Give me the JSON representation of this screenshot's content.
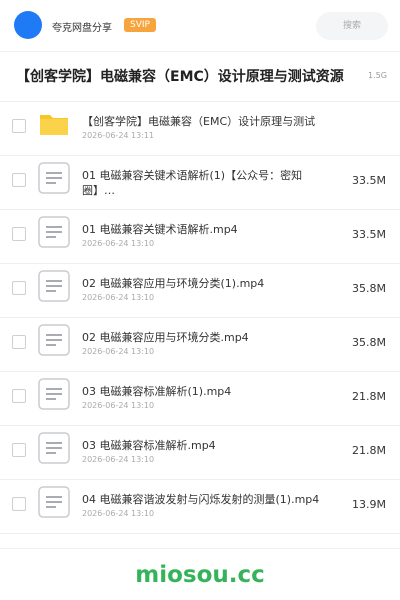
{
  "header": {
    "username": "夸克网盘分享",
    "badge": "SVIP",
    "search_placeholder": "搜索"
  },
  "folder_title": "【创客学院】电磁兼容（EMC）设计原理与测试资源",
  "total_size": "1.5G",
  "items": [
    {
      "type": "folder",
      "name": "【创客学院】电磁兼容（EMC）设计原理与测试",
      "date": "2026-06-24 13:11",
      "size": ""
    },
    {
      "type": "file",
      "name": "01 电磁兼容关键术语解析(1)【公众号：密知圈】…",
      "date": "",
      "size": "33.5M"
    },
    {
      "type": "file",
      "name": "01 电磁兼容关键术语解析.mp4",
      "date": "2026-06-24 13:10",
      "size": "33.5M"
    },
    {
      "type": "file",
      "name": "02 电磁兼容应用与环境分类(1).mp4",
      "date": "2026-06-24 13:10",
      "size": "35.8M"
    },
    {
      "type": "file",
      "name": "02 电磁兼容应用与环境分类.mp4",
      "date": "2026-06-24 13:10",
      "size": "35.8M"
    },
    {
      "type": "file",
      "name": "03 电磁兼容标准解析(1).mp4",
      "date": "2026-06-24 13:10",
      "size": "21.8M"
    },
    {
      "type": "file",
      "name": "03 电磁兼容标准解析.mp4",
      "date": "2026-06-24 13:10",
      "size": "21.8M"
    },
    {
      "type": "file",
      "name": "04 电磁兼容谐波发射与闪烁发射的测量(1).mp4",
      "date": "2026-06-24 13:10",
      "size": "13.9M"
    }
  ],
  "watermark": "miosou.cc",
  "colors": {
    "accent": "#1e7af5",
    "badge": "#f7a43d",
    "folder": "#f9c529",
    "watermark": "#35b35a"
  },
  "icons": {
    "folder": "folder-icon",
    "file": "file-doc-icon"
  }
}
